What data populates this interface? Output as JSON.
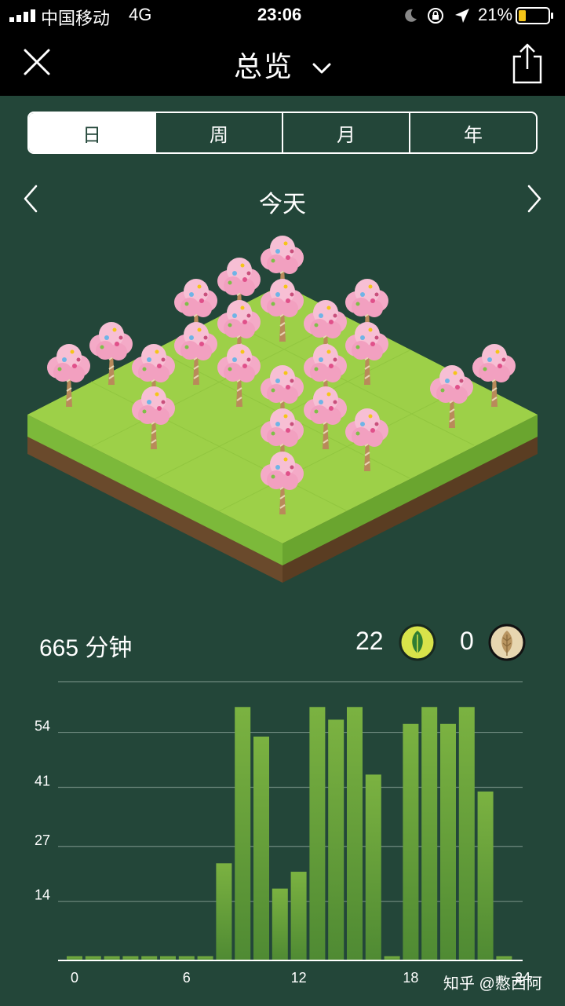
{
  "status_bar": {
    "carrier": "中国移动",
    "network": "4G",
    "time": "23:06",
    "battery": "21%",
    "icons": [
      "signal-icon",
      "moon-icon",
      "rotation-lock-icon",
      "location-arrow-icon",
      "battery-icon"
    ]
  },
  "nav": {
    "title": "总览",
    "icons": [
      "close-icon",
      "chevron-down-icon",
      "share-icon"
    ]
  },
  "segments": {
    "items": [
      "日",
      "周",
      "月",
      "年"
    ],
    "selected": "日"
  },
  "date_nav": {
    "label": "今天",
    "icons": [
      "chevron-left-icon",
      "chevron-right-icon"
    ]
  },
  "summary": {
    "minutes": "665 分钟",
    "healthy_count": "22",
    "withered_count": "0",
    "icons": [
      "green-leaf-icon",
      "withered-leaf-icon"
    ]
  },
  "colors": {
    "background": "#234639",
    "bar": "#7bb241",
    "grass": "#9dd048",
    "blossom": "#f5b7cf"
  },
  "chart_data": {
    "type": "bar",
    "x": [
      0,
      1,
      2,
      3,
      4,
      5,
      6,
      7,
      8,
      9,
      10,
      11,
      12,
      13,
      14,
      15,
      16,
      17,
      18,
      19,
      20,
      21,
      22,
      23
    ],
    "values": [
      1,
      1,
      1,
      1,
      1,
      1,
      1,
      1,
      23,
      60,
      53,
      17,
      21,
      60,
      57,
      60,
      44,
      1,
      56,
      60,
      56,
      60,
      40,
      1
    ],
    "x_tick_labels": [
      "0",
      "6",
      "12",
      "18",
      "24"
    ],
    "y_ticks": [
      14,
      27,
      41,
      54
    ],
    "y_tick_labels": [
      "14",
      "27",
      "41",
      "54"
    ],
    "ylim": [
      0,
      66
    ],
    "grid": true
  },
  "watermark": "知乎 @懯西阿"
}
